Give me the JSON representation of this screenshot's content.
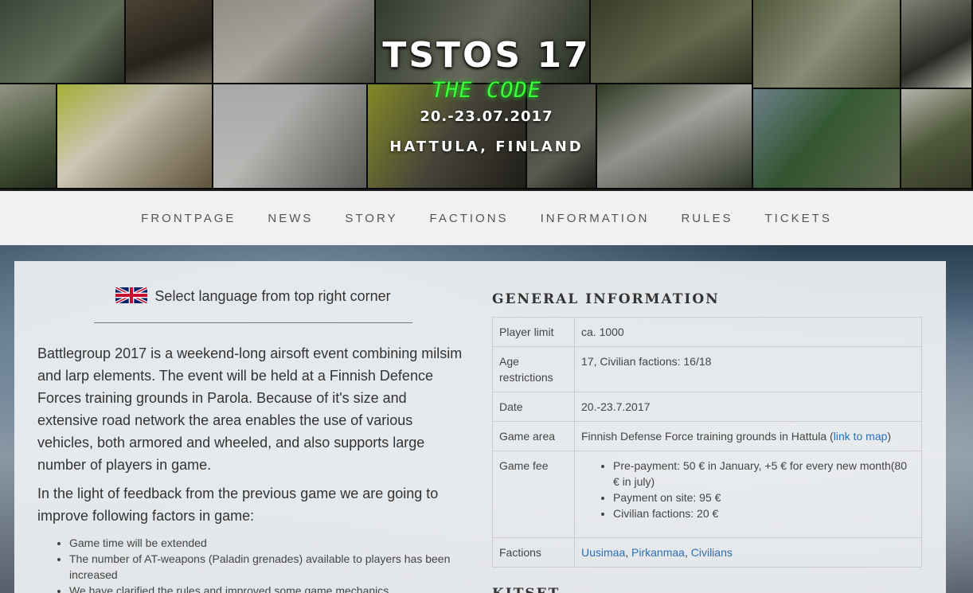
{
  "hero": {
    "title": "TSTOS 17",
    "subtitle": "THE CODE",
    "date": "20.-23.07.2017",
    "location": "HATTULA, FINLAND"
  },
  "nav": {
    "items": [
      "FRONTPAGE",
      "NEWS",
      "STORY",
      "FACTIONS",
      "INFORMATION",
      "RULES",
      "TICKETS"
    ]
  },
  "language": {
    "text": "Select language from top right corner",
    "flag_icon": "uk-flag-icon"
  },
  "intro": {
    "paragraph1": "Battlegroup 2017 is a weekend-long airsoft event combining milsim and larp elements. The event will be held at a Finnish Defence Forces training grounds in Parola. Because of it's size and extensive road network the area enables the use of various vehicles, both armored and wheeled, and also supports large number of players in game.",
    "paragraph2": "In the light of feedback from the previous game we are going to improve following factors in game:",
    "improvements": [
      "Game time will be extended",
      "The number of AT-weapons (Paladin grenades) available to players has been increased",
      "We have clarified the rules and improved some game mechanics"
    ]
  },
  "general_info": {
    "title": "GENERAL INFORMATION",
    "player_limit_label": "Player limit",
    "player_limit_value": "ca. 1000",
    "age_label": "Age restrictions",
    "age_value": "17, Civilian factions: 16/18",
    "date_label": "Date",
    "date_value": "20.-23.7.2017",
    "area_label": "Game area",
    "area_value": "Finnish Defense Force training grounds in Hattula (",
    "area_link": "link to map",
    "area_close": ")",
    "fee_label": "Game fee",
    "fees": [
      "Pre-payment: 50 € in January, +5 € for every new month(80 € in july)",
      "Payment on site: 95 €",
      "Civilian factions: 20 €"
    ],
    "factions_label": "Factions",
    "faction_links": [
      "Uusimaa",
      "Pirkanmaa",
      "Civilians"
    ],
    "faction_sep": ", "
  },
  "kitset": {
    "title": "KITSET"
  },
  "colors": {
    "accent_green": "#3cff3c",
    "link": "#2a6fb4",
    "nav_bg": "#f1f1f1"
  }
}
